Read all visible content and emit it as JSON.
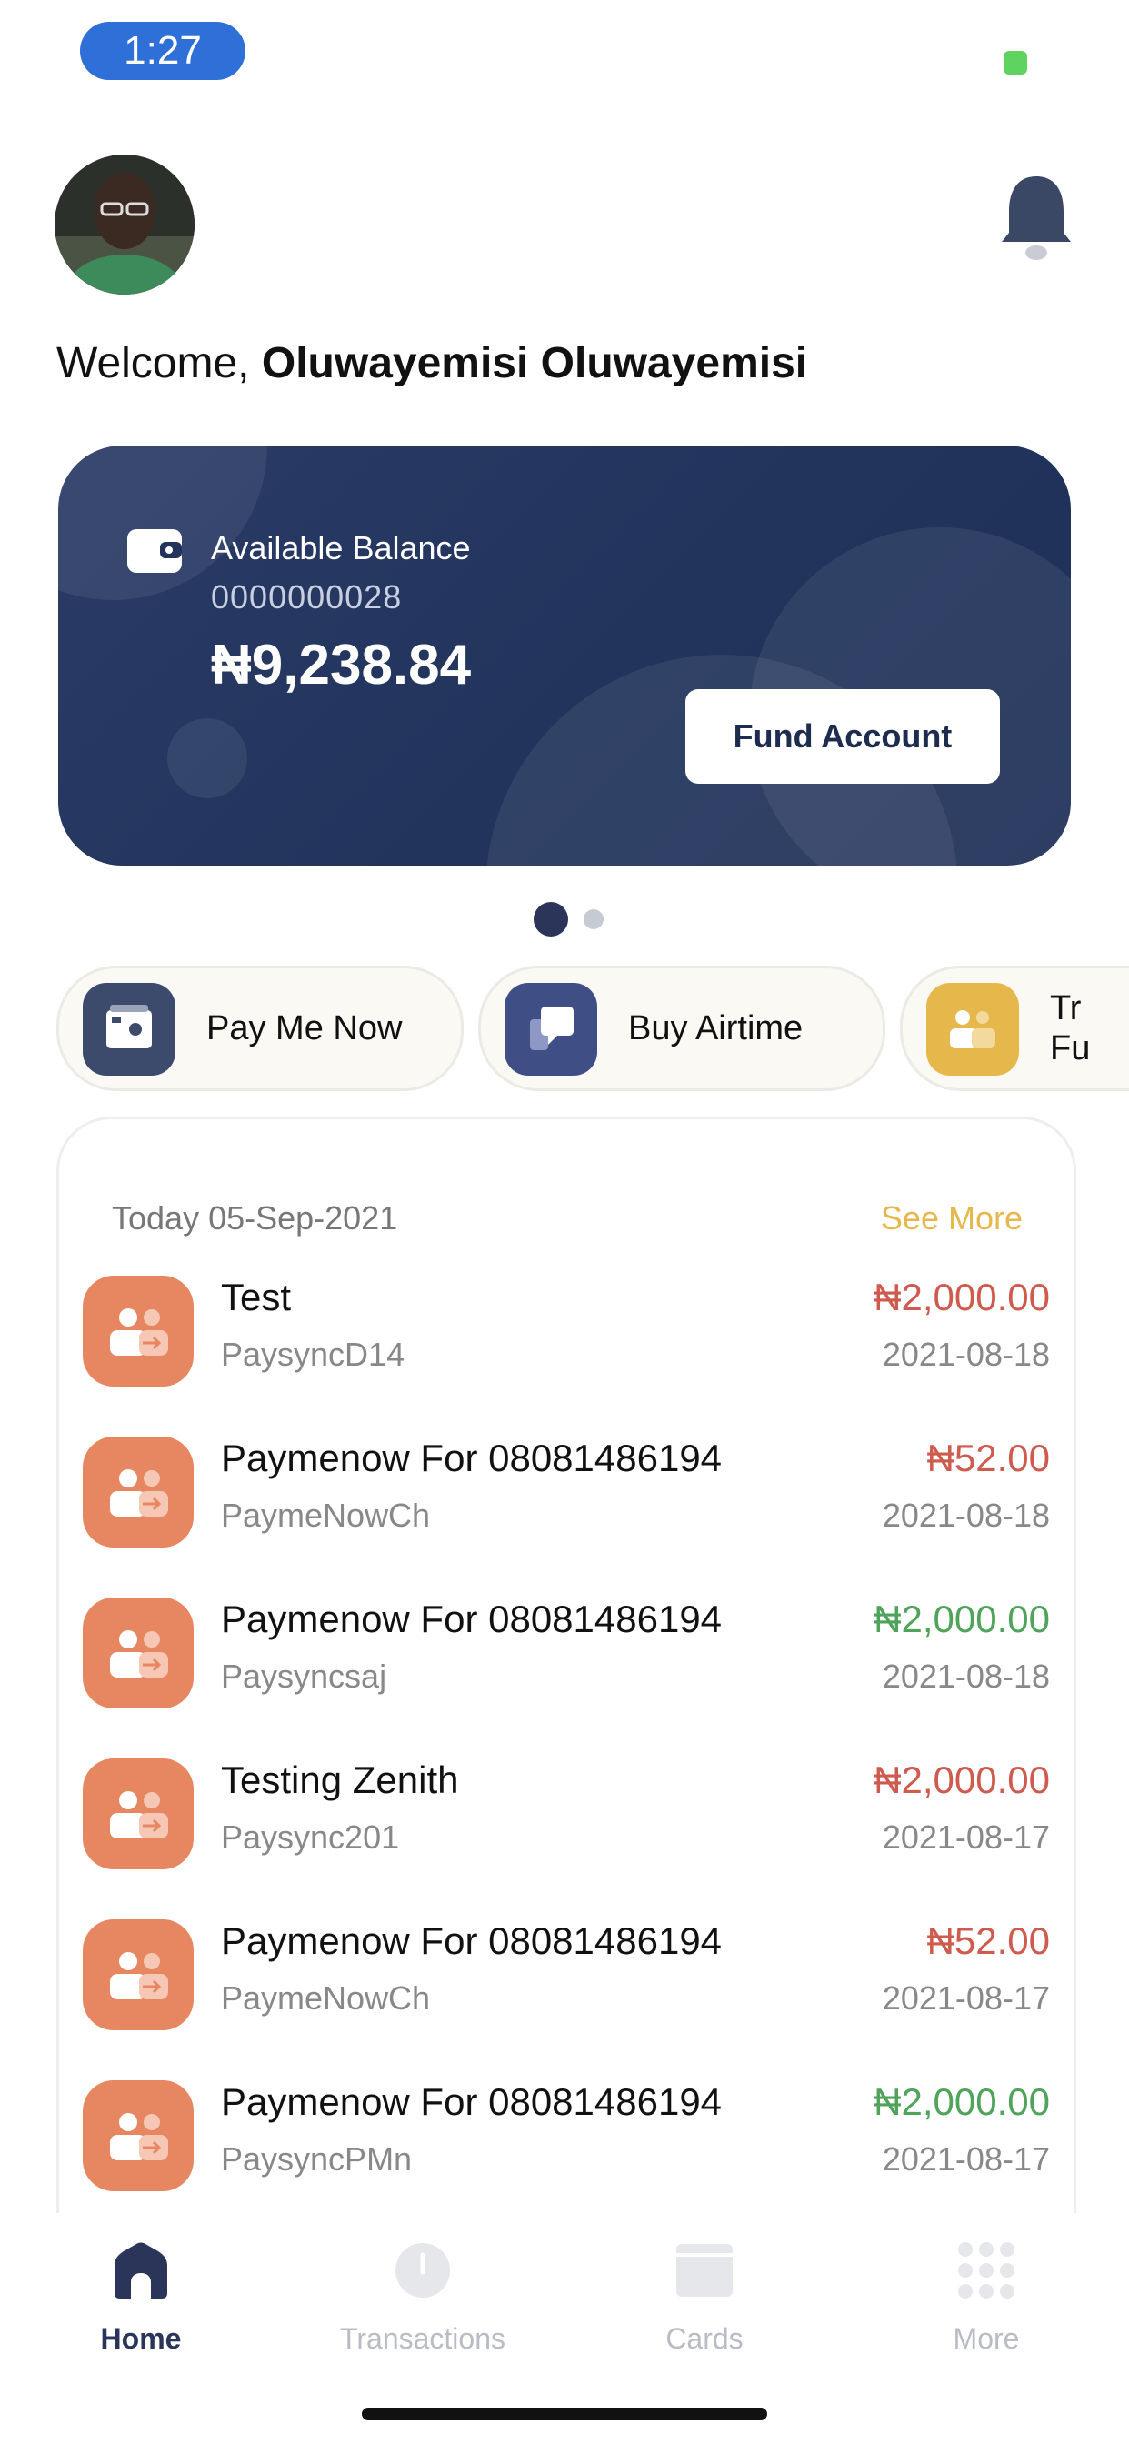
{
  "status_bar": {
    "time": "1:27"
  },
  "header": {
    "welcome_prefix": "Welcome,",
    "user_name": "Oluwayemisi Oluwayemisi"
  },
  "balance_card": {
    "label": "Available Balance",
    "account_number": "0000000028",
    "amount": "₦9,238.84",
    "fund_button": "Fund Account",
    "page_count": 2,
    "active_page": 1
  },
  "quick_actions": [
    {
      "label": "Pay Me Now",
      "icon": "wallet-cash-icon",
      "color": "#3c4a6c"
    },
    {
      "label": "Buy Airtime",
      "icon": "phone-airtime-icon",
      "color": "#3f4f86"
    },
    {
      "label": "Tr Fu",
      "icon": "transfer-funds-icon",
      "color": "#e6b84c"
    }
  ],
  "transactions_panel": {
    "date_label": "Today 05-Sep-2021",
    "see_more": "See More",
    "items": [
      {
        "title": "Test",
        "subtitle": "PaysyncD14",
        "amount": "₦2,000.00",
        "date": "2021-08-18",
        "direction": "debit"
      },
      {
        "title": "Paymenow For 08081486194",
        "subtitle": "PaymeNowCh",
        "amount": "₦52.00",
        "date": "2021-08-18",
        "direction": "debit"
      },
      {
        "title": "Paymenow For 08081486194",
        "subtitle": "Paysyncsaj",
        "amount": "₦2,000.00",
        "date": "2021-08-18",
        "direction": "credit"
      },
      {
        "title": "Testing Zenith",
        "subtitle": "Paysync201",
        "amount": "₦2,000.00",
        "date": "2021-08-17",
        "direction": "debit"
      },
      {
        "title": "Paymenow For 08081486194",
        "subtitle": "PaymeNowCh",
        "amount": "₦52.00",
        "date": "2021-08-17",
        "direction": "debit"
      },
      {
        "title": "Paymenow For 08081486194",
        "subtitle": "PaysyncPMn",
        "amount": "₦2,000.00",
        "date": "2021-08-17",
        "direction": "credit"
      }
    ]
  },
  "bottom_nav": {
    "items": [
      {
        "label": "Home",
        "icon": "home-icon",
        "active": true
      },
      {
        "label": "Transactions",
        "icon": "clock-icon",
        "active": false
      },
      {
        "label": "Cards",
        "icon": "card-icon",
        "active": false
      },
      {
        "label": "More",
        "icon": "grid-dots-icon",
        "active": false
      }
    ]
  },
  "colors": {
    "card_bg": "#22345c",
    "debit": "#cf5a4e",
    "credit": "#4fa35a",
    "accent_gold": "#e6b84c",
    "nav_active": "#2a3559",
    "nav_inactive": "#b9bcc4",
    "tx_icon": "#e78761"
  }
}
